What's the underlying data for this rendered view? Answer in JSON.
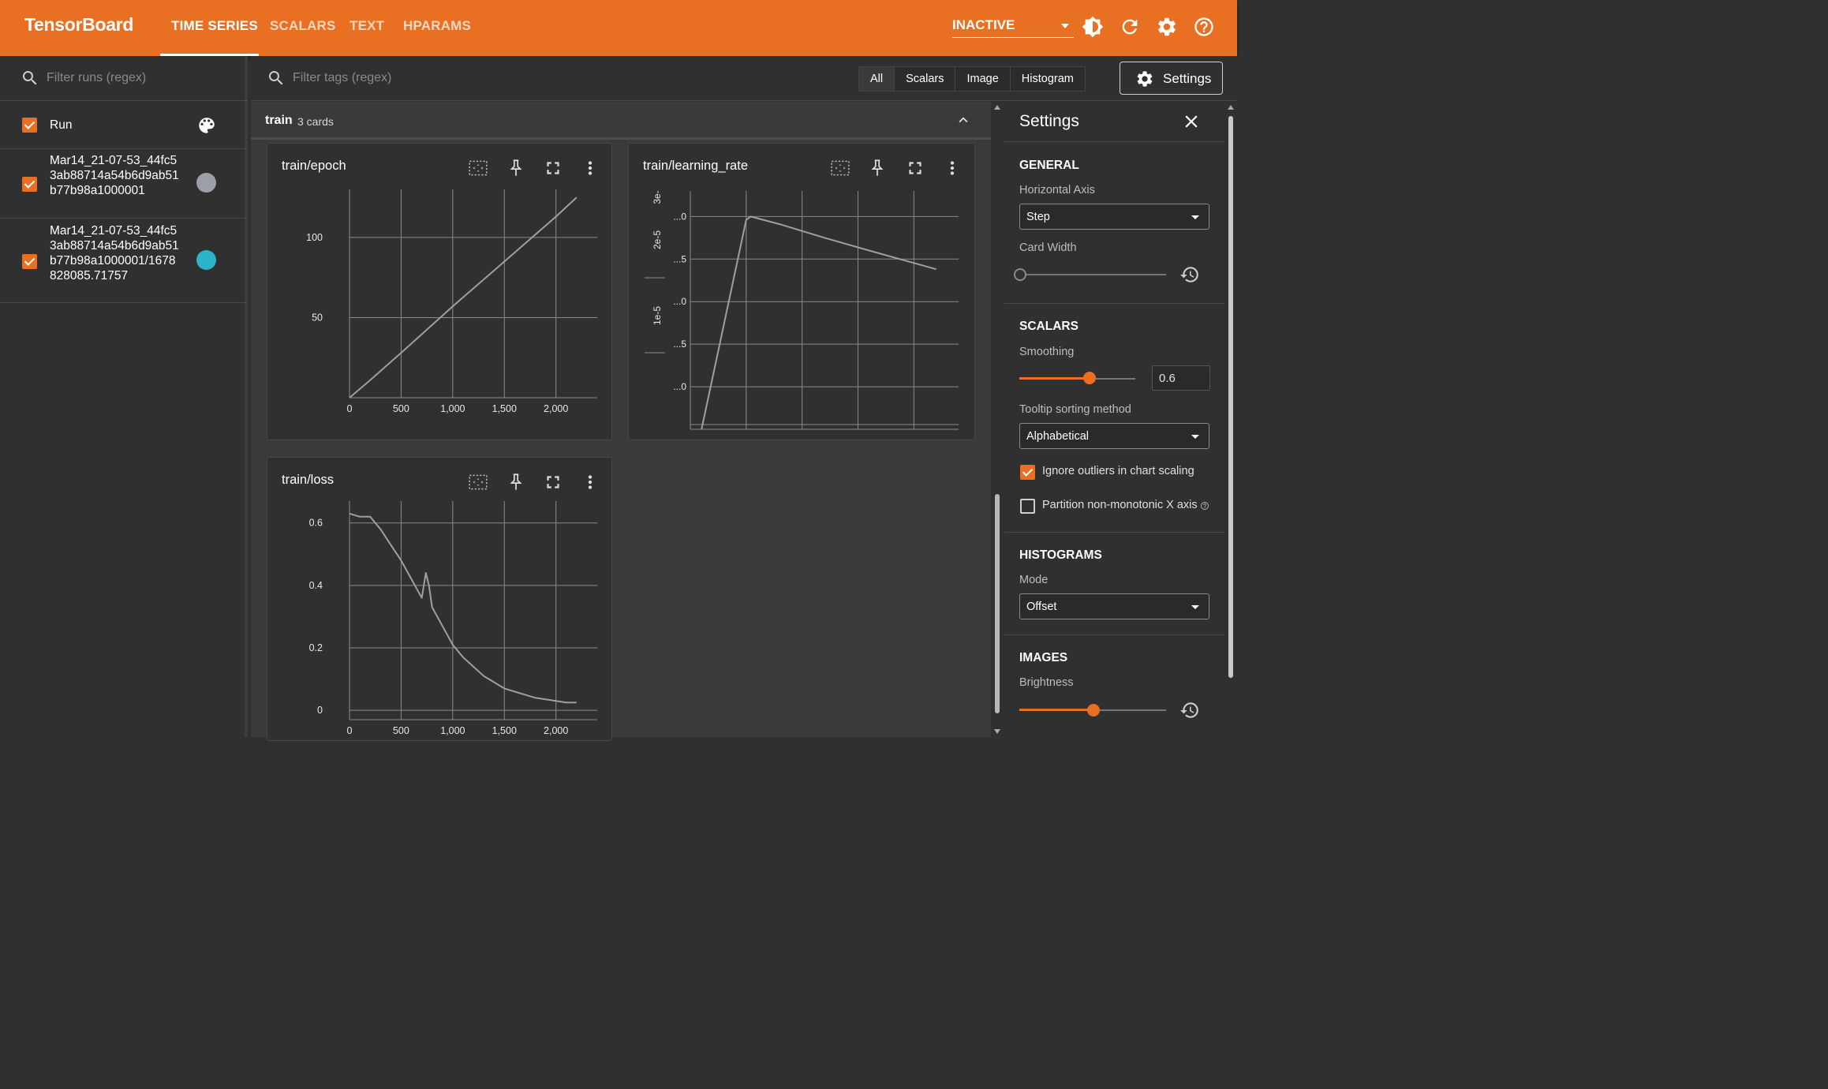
{
  "app": {
    "brand": "TensorBoard",
    "nav_tabs": [
      "TIME SERIES",
      "SCALARS",
      "TEXT",
      "HPARAMS"
    ],
    "active_tab": "TIME SERIES",
    "status_select": "INACTIVE",
    "icons": [
      "brightness-icon",
      "refresh-icon",
      "settings-gear-icon",
      "help-icon"
    ]
  },
  "sidebar": {
    "filter_placeholder": "Filter runs (regex)",
    "header_label": "Run",
    "runs": [
      {
        "name": "Mar14_21-07-53_44fc53ab88714a54b6d9ab51b77b98a1000001",
        "checked": true,
        "color": "#9aa0a6"
      },
      {
        "name": "Mar14_21-07-53_44fc53ab88714a54b6d9ab51b77b98a1000001/1678828085.71757",
        "checked": true,
        "color": "#2bb3c9"
      }
    ]
  },
  "main": {
    "tag_filter_placeholder": "Filter tags (regex)",
    "type_filters": [
      "All",
      "Scalars",
      "Image",
      "Histogram"
    ],
    "settings_button": "Settings",
    "group": {
      "name": "train",
      "count": "3 cards"
    }
  },
  "cards": [
    {
      "title": "train/epoch"
    },
    {
      "title": "train/learning_rate"
    },
    {
      "title": "train/loss"
    }
  ],
  "chart_data": [
    {
      "type": "line",
      "title": "train/epoch",
      "x_ticks": [
        "0",
        "500",
        "1,000",
        "1,500",
        "2,000"
      ],
      "y_ticks": [
        "50",
        "100"
      ],
      "xlim": [
        0,
        2400
      ],
      "ylim": [
        0,
        130
      ],
      "series": [
        {
          "x": [
            0,
            200,
            500,
            1000,
            1500,
            2000,
            2200
          ],
          "values": [
            0,
            11,
            28,
            57,
            85,
            113,
            125
          ]
        }
      ]
    },
    {
      "type": "line",
      "title": "train/learning_rate",
      "x_ticks": [
        "0",
        "500",
        "1,000",
        "1,500",
        "2,000"
      ],
      "y_ticks": [
        "...0",
        "...5",
        "...0",
        "...5",
        "...0"
      ],
      "y_group_labels": [
        "3e-",
        "2e-5",
        "1e-5"
      ],
      "xlim": [
        0,
        2400
      ],
      "ylim": [
        0,
        28
      ],
      "series": [
        {
          "x": [
            100,
            500,
            540,
            800,
            1200,
            1600,
            2200
          ],
          "values": [
            0,
            24.6,
            25.0,
            24.1,
            22.5,
            21.0,
            18.8
          ]
        }
      ]
    },
    {
      "type": "line",
      "title": "train/loss",
      "x_ticks": [
        "0",
        "500",
        "1,000",
        "1,500",
        "2,000"
      ],
      "y_ticks": [
        "0",
        "0.2",
        "0.4",
        "0.6"
      ],
      "xlim": [
        0,
        2400
      ],
      "ylim": [
        -0.03,
        0.67
      ],
      "series": [
        {
          "x": [
            0,
            100,
            200,
            250,
            300,
            400,
            500,
            600,
            700,
            740,
            770,
            800,
            900,
            1000,
            1100,
            1200,
            1300,
            1400,
            1500,
            1600,
            1700,
            1800,
            1900,
            2000,
            2100,
            2200
          ],
          "values": [
            0.63,
            0.62,
            0.62,
            0.6,
            0.58,
            0.53,
            0.48,
            0.42,
            0.36,
            0.44,
            0.4,
            0.33,
            0.27,
            0.21,
            0.17,
            0.14,
            0.11,
            0.09,
            0.07,
            0.06,
            0.05,
            0.04,
            0.035,
            0.03,
            0.025,
            0.025
          ]
        }
      ]
    }
  ],
  "settings": {
    "title": "Settings",
    "general": {
      "heading": "GENERAL",
      "horizontal_axis_label": "Horizontal Axis",
      "horizontal_axis_value": "Step",
      "card_width_label": "Card Width",
      "card_width_level": 0
    },
    "scalars": {
      "heading": "SCALARS",
      "smoothing_label": "Smoothing",
      "smoothing_value": "0.6",
      "smoothing_level": 0.6,
      "tooltip_label": "Tooltip sorting method",
      "tooltip_value": "Alphabetical",
      "ignore_outliers_label": "Ignore outliers in chart scaling",
      "ignore_outliers_checked": true,
      "partition_label": "Partition non-monotonic X axis",
      "partition_checked": false
    },
    "histograms": {
      "heading": "HISTOGRAMS",
      "mode_label": "Mode",
      "mode_value": "Offset"
    },
    "images": {
      "heading": "IMAGES",
      "brightness_label": "Brightness",
      "brightness_level": 0.5
    }
  },
  "colors": {
    "accent": "#e97022",
    "line": "#9aa0a6"
  }
}
